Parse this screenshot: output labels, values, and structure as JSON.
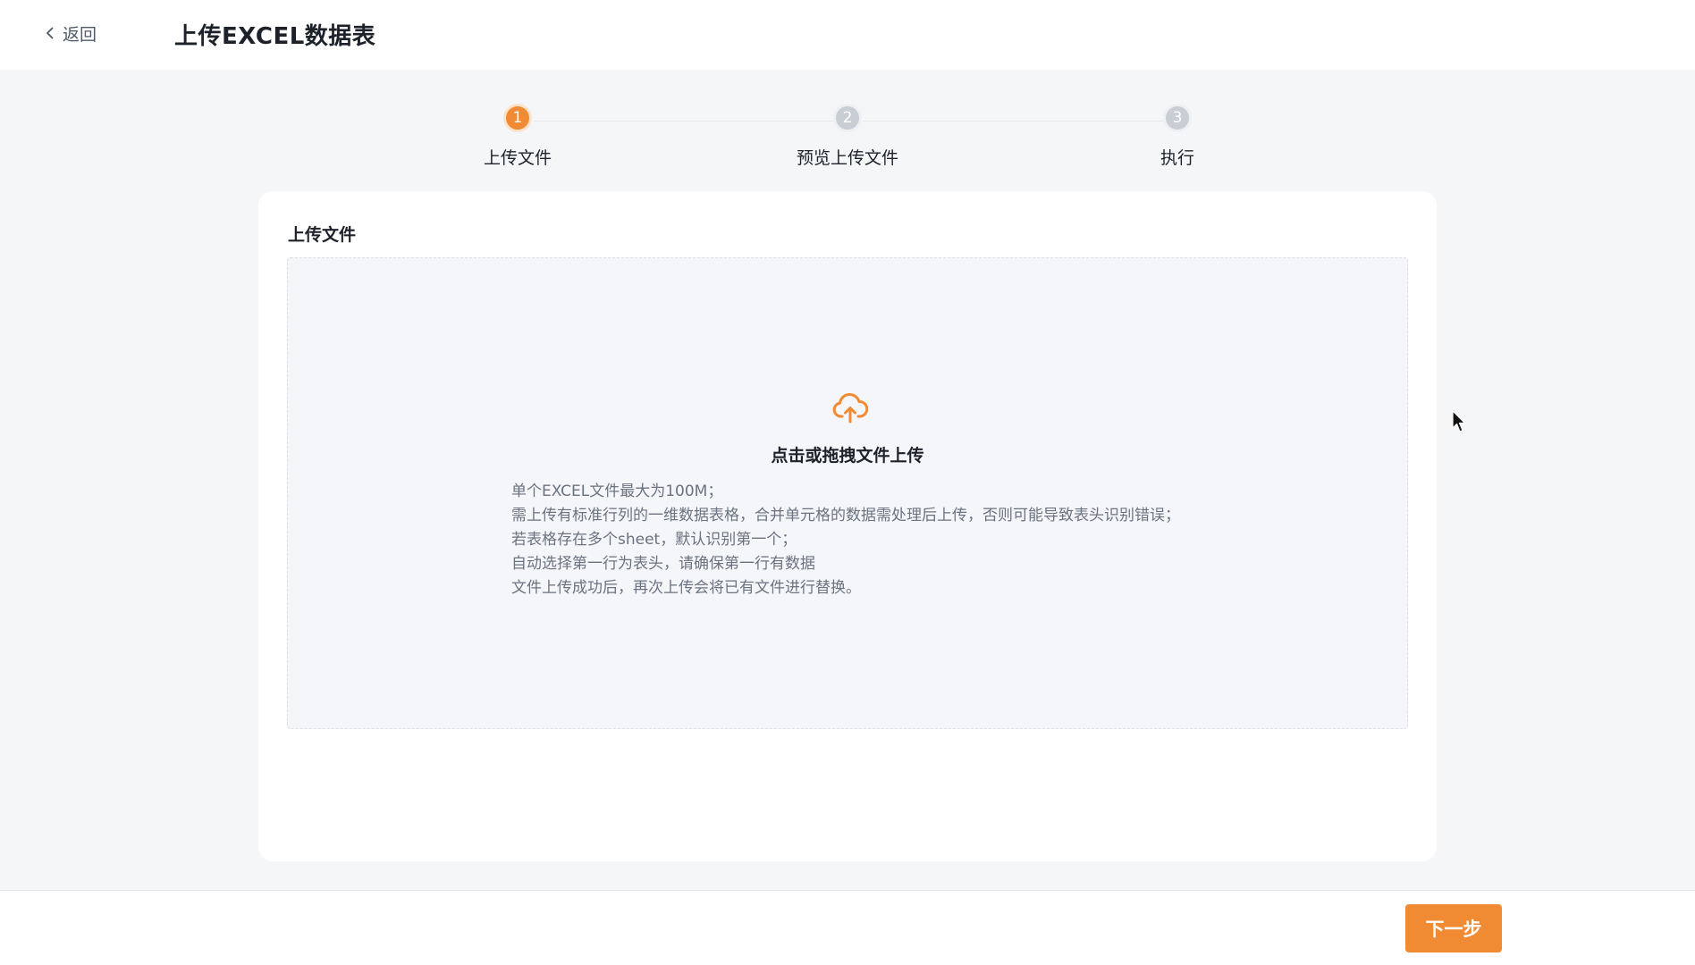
{
  "header": {
    "back_label": "返回",
    "title": "上传EXCEL数据表"
  },
  "steps": [
    {
      "number": "1",
      "label": "上传文件",
      "active": true
    },
    {
      "number": "2",
      "label": "预览上传文件",
      "active": false
    },
    {
      "number": "3",
      "label": "执行",
      "active": false
    }
  ],
  "upload": {
    "section_title": "上传文件",
    "drop_title": "点击或拖拽文件上传",
    "icon": "cloud-upload-icon",
    "hints": [
      "单个EXCEL文件最大为100M；",
      "需上传有标准行列的一维数据表格，合并单元格的数据需处理后上传，否则可能导致表头识别错误；",
      "若表格存在多个sheet，默认识别第一个；",
      "自动选择第一行为表头，请确保第一行有数据",
      "文件上传成功后，再次上传会将已有文件进行替换。"
    ]
  },
  "footer": {
    "next_label": "下一步"
  },
  "colors": {
    "accent": "#f08a33",
    "inactive_step": "#c9cdd4",
    "background": "#f5f6f8"
  }
}
